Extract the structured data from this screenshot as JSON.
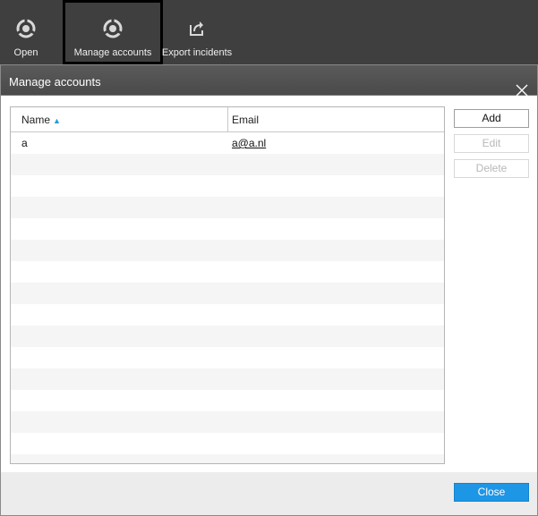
{
  "toolbar": {
    "items": [
      {
        "label": "Open",
        "icon": "account-ring-icon"
      },
      {
        "label": "Manage accounts",
        "icon": "account-ring-icon"
      },
      {
        "label": "Export incidents",
        "icon": "export-icon"
      }
    ]
  },
  "dialog": {
    "title": "Manage accounts",
    "table": {
      "columns": [
        "Name",
        "Email"
      ],
      "sort_indicator": "▲",
      "rows": [
        {
          "name": "a",
          "email": "a@a.nl"
        }
      ]
    },
    "buttons": {
      "add": "Add",
      "edit": "Edit",
      "delete": "Delete",
      "close": "Close"
    }
  },
  "colors": {
    "toolbar_bg": "#3f3f3f",
    "primary_button": "#1e96e6",
    "sort_arrow": "#2a9ad9"
  }
}
